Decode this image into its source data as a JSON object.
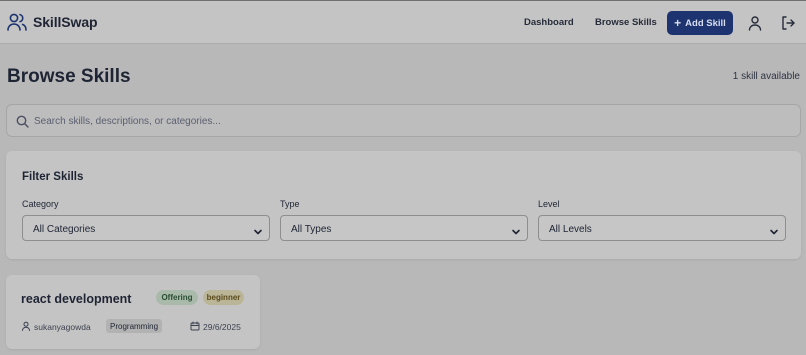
{
  "brand": {
    "name": "SkillSwap",
    "icon": "users-icon"
  },
  "nav": {
    "dashboard": "Dashboard",
    "browse": "Browse Skills",
    "add_skill": "Add Skill",
    "profile_icon": "user-icon",
    "logout_icon": "logout-icon"
  },
  "page": {
    "title": "Browse Skills",
    "count": "1 skill available"
  },
  "search": {
    "placeholder": "Search skills, descriptions, or categories...",
    "value": ""
  },
  "filters": {
    "title": "Filter Skills",
    "category": {
      "label": "Category",
      "selected": "All Categories"
    },
    "type": {
      "label": "Type",
      "selected": "All Types"
    },
    "level": {
      "label": "Level",
      "selected": "All Levels"
    }
  },
  "skills": [
    {
      "title": "react development",
      "type": "Offering",
      "level": "beginner",
      "user": "sukanyagowda",
      "category": "Programming",
      "date": "29/6/2025"
    }
  ],
  "colors": {
    "primary_button": "#1d3470",
    "offering_badge": "#a9b9aa",
    "level_badge": "#bbb597"
  }
}
